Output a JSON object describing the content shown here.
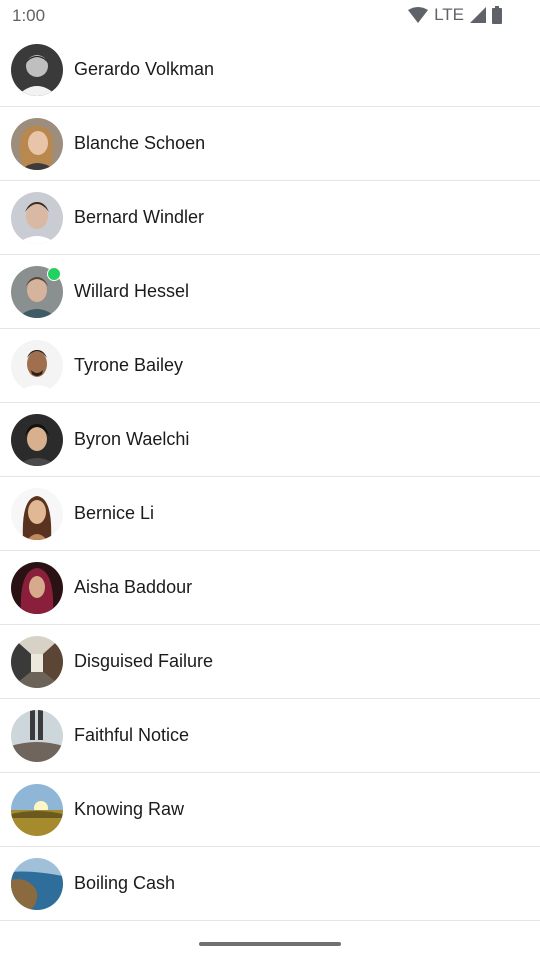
{
  "status_bar": {
    "time": "1:00",
    "network_label": "LTE",
    "icons": [
      "wifi-icon",
      "cell-signal-icon",
      "battery-icon"
    ]
  },
  "contacts": [
    {
      "name": "Gerardo Volkman",
      "avatar": "person-photo",
      "online": false
    },
    {
      "name": "Blanche Schoen",
      "avatar": "person-photo",
      "online": false
    },
    {
      "name": "Bernard Windler",
      "avatar": "person-photo",
      "online": false
    },
    {
      "name": "Willard Hessel",
      "avatar": "person-photo",
      "online": true
    },
    {
      "name": "Tyrone Bailey",
      "avatar": "person-photo",
      "online": false
    },
    {
      "name": "Byron Waelchi",
      "avatar": "person-photo",
      "online": false
    },
    {
      "name": "Bernice Li",
      "avatar": "person-photo",
      "online": false
    },
    {
      "name": "Aisha Baddour",
      "avatar": "person-photo",
      "online": false
    },
    {
      "name": "Disguised Failure",
      "avatar": "corridor-photo",
      "online": false
    },
    {
      "name": "Faithful Notice",
      "avatar": "legs-on-rocks-photo",
      "online": false
    },
    {
      "name": "Knowing Raw",
      "avatar": "sunset-field-photo",
      "online": false
    },
    {
      "name": "Boiling Cash",
      "avatar": "coastline-photo",
      "online": false
    }
  ],
  "colors": {
    "online_indicator": "#22d15f",
    "divider": "#e6e6e6",
    "text": "#1b1b1b"
  }
}
